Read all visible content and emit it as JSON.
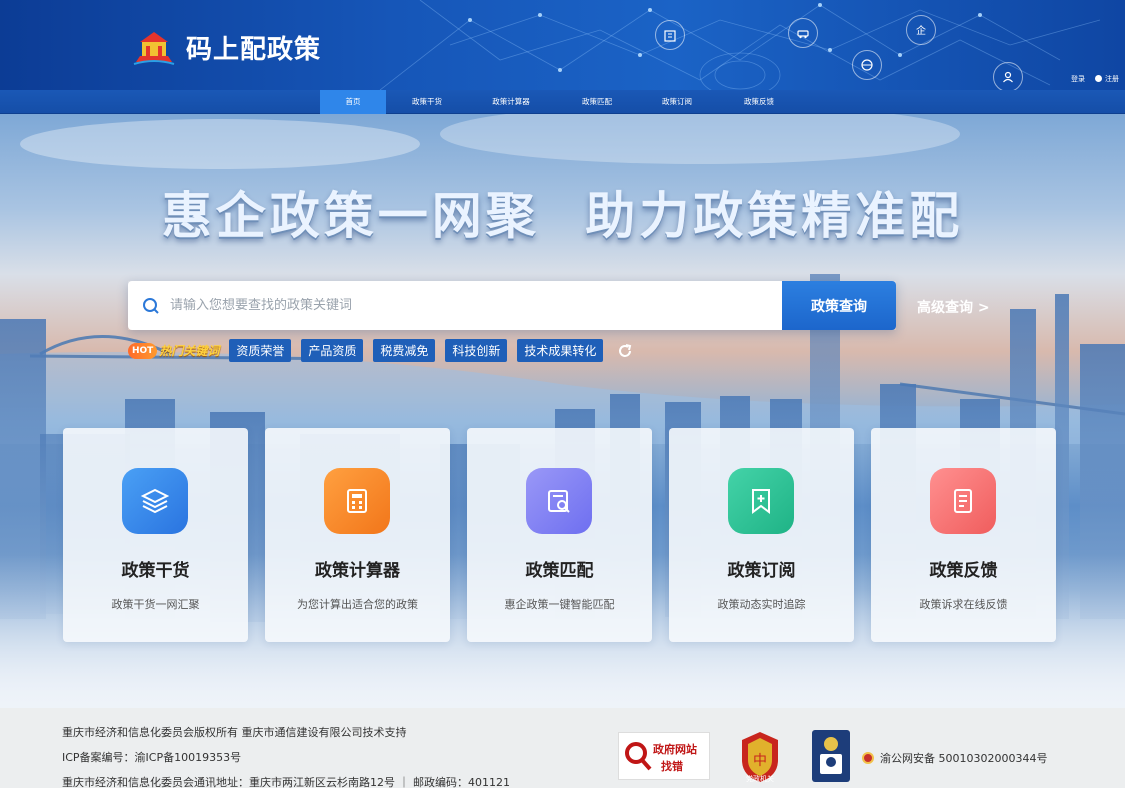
{
  "header": {
    "logo_text": "码上配政策",
    "login": "登录",
    "register": "注册"
  },
  "nav": {
    "items": [
      {
        "label": "首页",
        "active": true
      },
      {
        "label": "政策干货",
        "active": false
      },
      {
        "label": "政策计算器",
        "active": false
      },
      {
        "label": "政策匹配",
        "active": false
      },
      {
        "label": "政策订阅",
        "active": false
      },
      {
        "label": "政策反馈",
        "active": false
      }
    ]
  },
  "hero": {
    "slogan": "惠企政策一网聚 助力政策精准配",
    "search": {
      "placeholder": "请输入您想要查找的政策关键词",
      "button": "政策查询",
      "advanced": "高级查询 >"
    },
    "hot": {
      "badge": "HOT",
      "label": "热门关键词",
      "tags": [
        "资质荣誉",
        "产品资质",
        "税费减免",
        "科技创新",
        "技术成果转化"
      ],
      "refresh_icon": "refresh-icon"
    }
  },
  "cards": [
    {
      "title": "政策干货",
      "desc": "政策干货一网汇聚",
      "icon": "layers-icon",
      "color": "#2f82ea"
    },
    {
      "title": "政策计算器",
      "desc": "为您计算出适合您的政策",
      "icon": "calculator-icon",
      "color": "#f5821f"
    },
    {
      "title": "政策匹配",
      "desc": "惠企政策一键智能匹配",
      "icon": "document-search-icon",
      "color": "#7d7ff0"
    },
    {
      "title": "政策订阅",
      "desc": "政策动态实时追踪",
      "icon": "bookmark-plus-icon",
      "color": "#2dbf95"
    },
    {
      "title": "政策反馈",
      "desc": "政策诉求在线反馈",
      "icon": "feedback-icon",
      "color": "#f56f6f"
    }
  ],
  "footer": {
    "line1": "重庆市经济和信息化委员会版权所有 重庆市通信建设有限公司技术支持",
    "line2": "ICP备案编号：渝ICP备10019353号",
    "line3": "重庆市经济和信息化委员会通讯地址：重庆市两江新区云杉南路12号 ｜ 邮政编码：401121",
    "gov_badge_1": "政府网站",
    "gov_badge_2": "找错",
    "party_badge": "党政机关",
    "police_record": "渝公网安备 50010302000344号"
  }
}
